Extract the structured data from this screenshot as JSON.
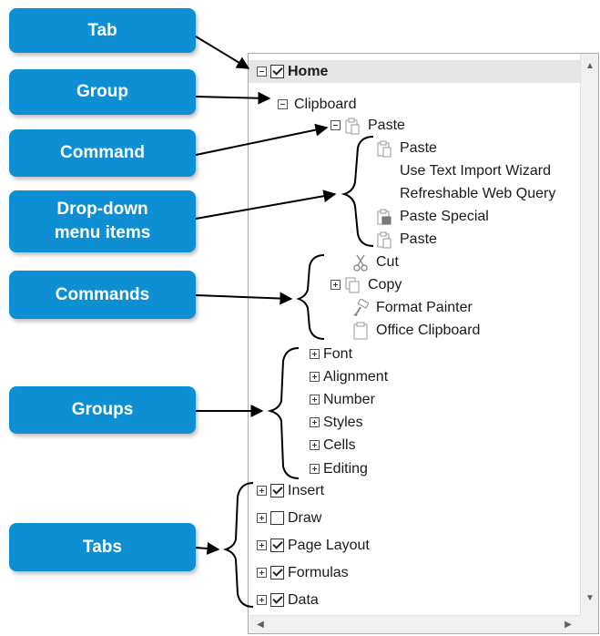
{
  "callouts": {
    "tab": "Tab",
    "group": "Group",
    "command": "Command",
    "dropdown": "Drop-down\nmenu items",
    "commands": "Commands",
    "groups": "Groups",
    "tabs": "Tabs"
  },
  "tree": {
    "home": "Home",
    "clipboard": "Clipboard",
    "paste_cmd": "Paste",
    "paste_items": [
      "Paste",
      "Use Text Import Wizard",
      "Refreshable Web Query",
      "Paste Special",
      "Paste"
    ],
    "commands": [
      "Cut",
      "Copy",
      "Format Painter",
      "Office Clipboard"
    ],
    "groups": [
      "Font",
      "Alignment",
      "Number",
      "Styles",
      "Cells",
      "Editing"
    ],
    "tabs": [
      {
        "label": "Insert",
        "checked": true
      },
      {
        "label": "Draw",
        "checked": false
      },
      {
        "label": "Page Layout",
        "checked": true
      },
      {
        "label": "Formulas",
        "checked": true
      },
      {
        "label": "Data",
        "checked": true
      }
    ]
  },
  "scroll": {
    "up": "▲",
    "down": "▼",
    "left": "◀",
    "right": "▶"
  },
  "colors": {
    "callout": "#0f8fd3",
    "arrow": "#000000"
  }
}
